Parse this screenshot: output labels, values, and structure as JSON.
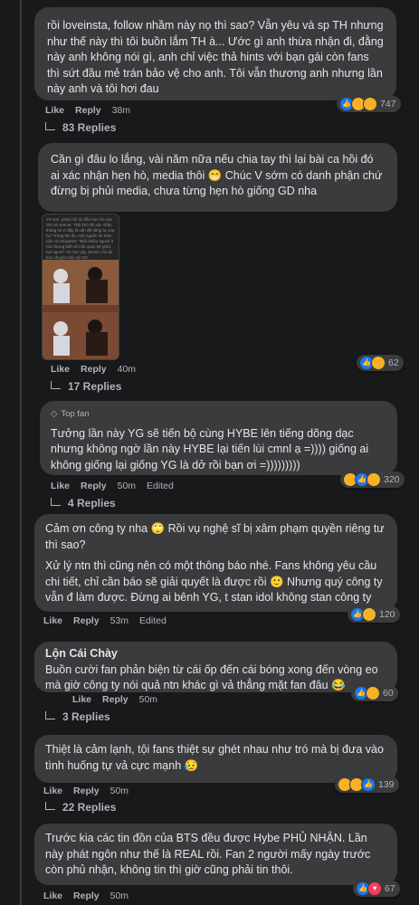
{
  "comments": [
    {
      "text": "rồi loveinsta, follow nhầm này nọ thì sao? Vẫn yêu và sp TH nhưng như thế này thì tôi buồn lắm TH à... Ước gì anh thừa nhận đi, đằng này anh không nói gì, anh chỉ việc thả hints với bạn gái còn fans thì sứt đầu mẻ trán bảo vệ cho anh. Tôi vẫn thương anh nhưng lần này anh và tôi hơi đau",
      "like": "Like",
      "reply": "Reply",
      "time": "38m",
      "reactions": "747",
      "replies": "83 Replies"
    },
    {
      "text": "Cần gì đâu lo lắng, vài năm nữa nếu chia tay thì lại bài ca hồi đó ai xác nhận hẹn hò, media thôi 😁 Chúc V sớm có danh phận chứ đừng bị phủi media, chưa từng hẹn hò giống GD nha",
      "screenshot_text": "YG Ent. phản hồi tin đồn hẹn hò của GD và Jennie: \"Rất khó để xác nhận thông tin vì đây là vấn đề riêng tư của họ\" Trong khi đó, một nguồn tin thân cận với Dispatch: \"Mối nhiều người ít hỏi nhưng biết về mối quan hệ giữa hai người\" và như vậy Jennie còn lôi kéo chuyện bảo vệ GD.",
      "like": "Like",
      "reply": "Reply",
      "time": "40m",
      "reactions": "62",
      "replies": "17 Replies"
    },
    {
      "badge": "Top fan",
      "text": "Tưởng lần này YG sẽ tiến bộ cùng HYBE lên tiếng dõng dạc nhưng không ngờ lần này HYBE lại tiến lùi cmnl ạ =)))) giống ai không giống lại giống YG là dở rồi bạn ơi =)))))))))",
      "like": "Like",
      "reply": "Reply",
      "time": "50m",
      "edited": "Edited",
      "reactions": "320",
      "replies": "4 Replies"
    },
    {
      "text": "Cảm ơn công ty nha 🙄 Rồi vụ nghệ sĩ bị xâm phạm quyền riêng tư thì sao?",
      "text2": "Xử lý ntn thì cũng nên có một thông báo nhé. Fans không yêu cầu chi tiết, chỉ cần báo sẽ giải quyết là được rồi 🙂 Nhưng quý công ty vẫn đ làm được. Đừng ai bênh YG, t stan idol không stan công ty",
      "like": "Like",
      "reply": "Reply",
      "time": "53m",
      "edited": "Edited",
      "reactions": "120"
    },
    {
      "name": "Lộn Cái Chày",
      "text": "Buồn cười fan phản biện từ cái ốp đến cái bóng xong đến vòng eo mà giờ công ty nói quả ntn khác gì vả thẳng mặt fan đâu 😂",
      "like": "Like",
      "reply": "Reply",
      "time": "50m",
      "reactions": "60",
      "replies": "3 Replies"
    },
    {
      "text": "Thiệt là cảm lạnh, tội fans thiệt sự ghét nhau như tró mà bị đưa vào tình huống tự vả cực mạnh 😥",
      "like": "Like",
      "reply": "Reply",
      "time": "50m",
      "reactions": "139",
      "replies": "22 Replies"
    },
    {
      "text": "Trước kia các tin đồn của BTS đều được Hybe PHỦ NHẬN. Lần này phát ngôn như thế là REAL rồi. Fan 2 người mấy ngày trước còn phủ nhận, không tin thì giờ cũng phải tin thôi.",
      "like": "Like",
      "reply": "Reply",
      "time": "50m",
      "reactions": "67"
    }
  ]
}
